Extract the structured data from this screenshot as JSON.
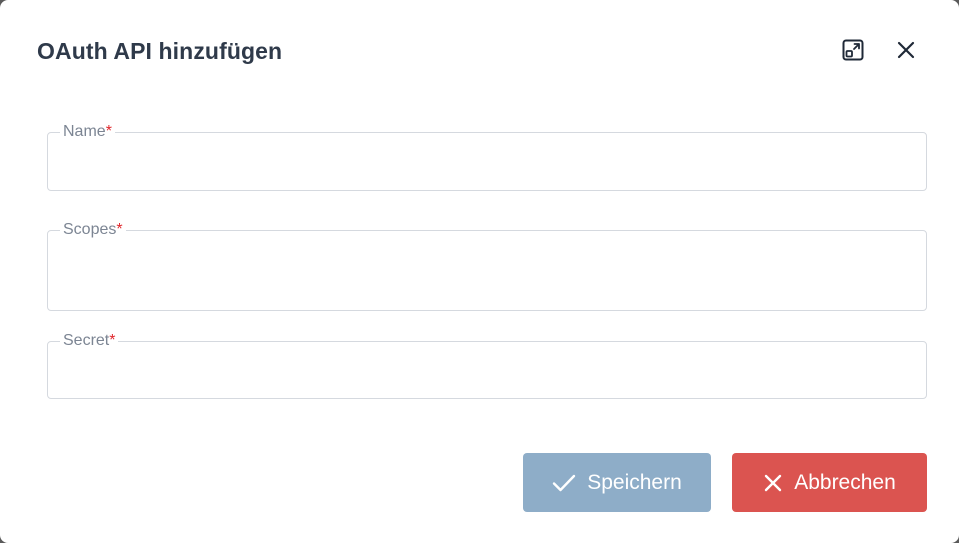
{
  "dialog": {
    "title": "OAuth API hinzufügen",
    "icons": {
      "expand": "expand-icon",
      "close": "close-icon"
    }
  },
  "fields": [
    {
      "label": "Name",
      "required_marker": "*",
      "value": "",
      "type": "text"
    },
    {
      "label": "Scopes",
      "required_marker": "*",
      "value": "",
      "type": "textarea"
    },
    {
      "label": "Secret",
      "required_marker": "*",
      "value": "",
      "type": "password"
    }
  ],
  "buttons": {
    "save": {
      "label": "Speichern",
      "icon": "check-icon",
      "color": "#8eadc8",
      "state": "disabled"
    },
    "cancel": {
      "label": "Abbrechen",
      "icon": "close-icon",
      "color": "#db5450"
    }
  },
  "colors": {
    "title": "#2f3a4a",
    "label": "#7c8593",
    "required": "#e0262b",
    "border": "#d5d9df"
  }
}
